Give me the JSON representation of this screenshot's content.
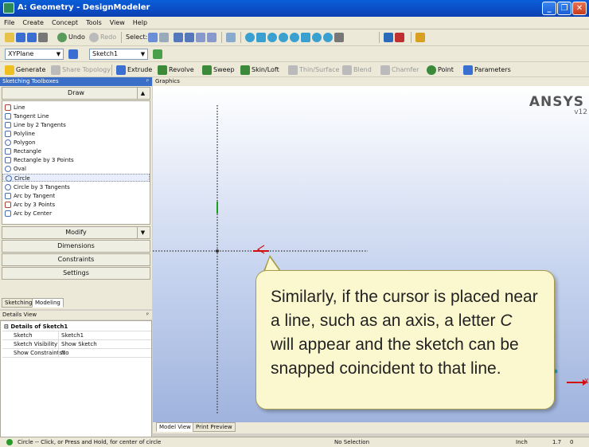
{
  "window": {
    "title": "A: Geometry - DesignModeler",
    "buttons": [
      "_",
      "❐",
      "✕"
    ]
  },
  "menu": [
    "File",
    "Create",
    "Concept",
    "Tools",
    "View",
    "Help"
  ],
  "toolbar1": {
    "undo": "Undo",
    "redo": "Redo",
    "select": "Select:"
  },
  "toolbar2": {
    "plane": "XYPlane",
    "sketch": "Sketch1"
  },
  "toolbar3": {
    "generate": "Generate",
    "share": "Share Topology",
    "extrude": "Extrude",
    "revolve": "Revolve",
    "sweep": "Sweep",
    "skinloft": "Skin/Loft",
    "thin": "Thin/Surface",
    "blend": "Blend",
    "chamfer": "Chamfer",
    "point": "Point",
    "parameters": "Parameters"
  },
  "toolbox": {
    "header": "Sketching Toolboxes",
    "draw_label": "Draw",
    "draw_items": [
      "Line",
      "Tangent Line",
      "Line by 2 Tangents",
      "Polyline",
      "Polygon",
      "Rectangle",
      "Rectangle by 3 Points",
      "Oval",
      "Circle",
      "Circle by 3 Tangents",
      "Arc by Tangent",
      "Arc by 3 Points",
      "Arc by Center"
    ],
    "active_item": "Circle",
    "sections": [
      "Modify",
      "Dimensions",
      "Constraints",
      "Settings"
    ]
  },
  "mode_tabs": [
    "Sketching",
    "Modeling"
  ],
  "details": {
    "header": "Details View",
    "group": "Details of Sketch1",
    "rows": [
      {
        "key": "Sketch",
        "value": "Sketch1"
      },
      {
        "key": "Sketch Visibility",
        "value": "Show Sketch"
      },
      {
        "key": "Show Constraints?",
        "value": "No"
      }
    ]
  },
  "graphics": {
    "header": "Graphics",
    "logo": "ANSYS",
    "version": "v12",
    "snap_letter": "C",
    "axis_label": "X"
  },
  "callout": {
    "text_before": "Similarly, if the cursor is placed near a line, such as an axis, a letter ",
    "letter": "C",
    "text_after": " will appear and the sketch can be snapped coincident to that line."
  },
  "view_tabs": [
    "Model View",
    "Print Preview"
  ],
  "status": {
    "message": "Circle -- Click, or Press and Hold, for center of circle",
    "selection": "No Selection",
    "units": "Inch",
    "x": "1.7",
    "y": "0"
  },
  "colors": {
    "titlebar": "#0b4cc4",
    "panel_header": "#3b6fc7",
    "callout_bg": "#fbf8cf",
    "axis_dots": "#333333",
    "snap_red": "#d01010"
  }
}
